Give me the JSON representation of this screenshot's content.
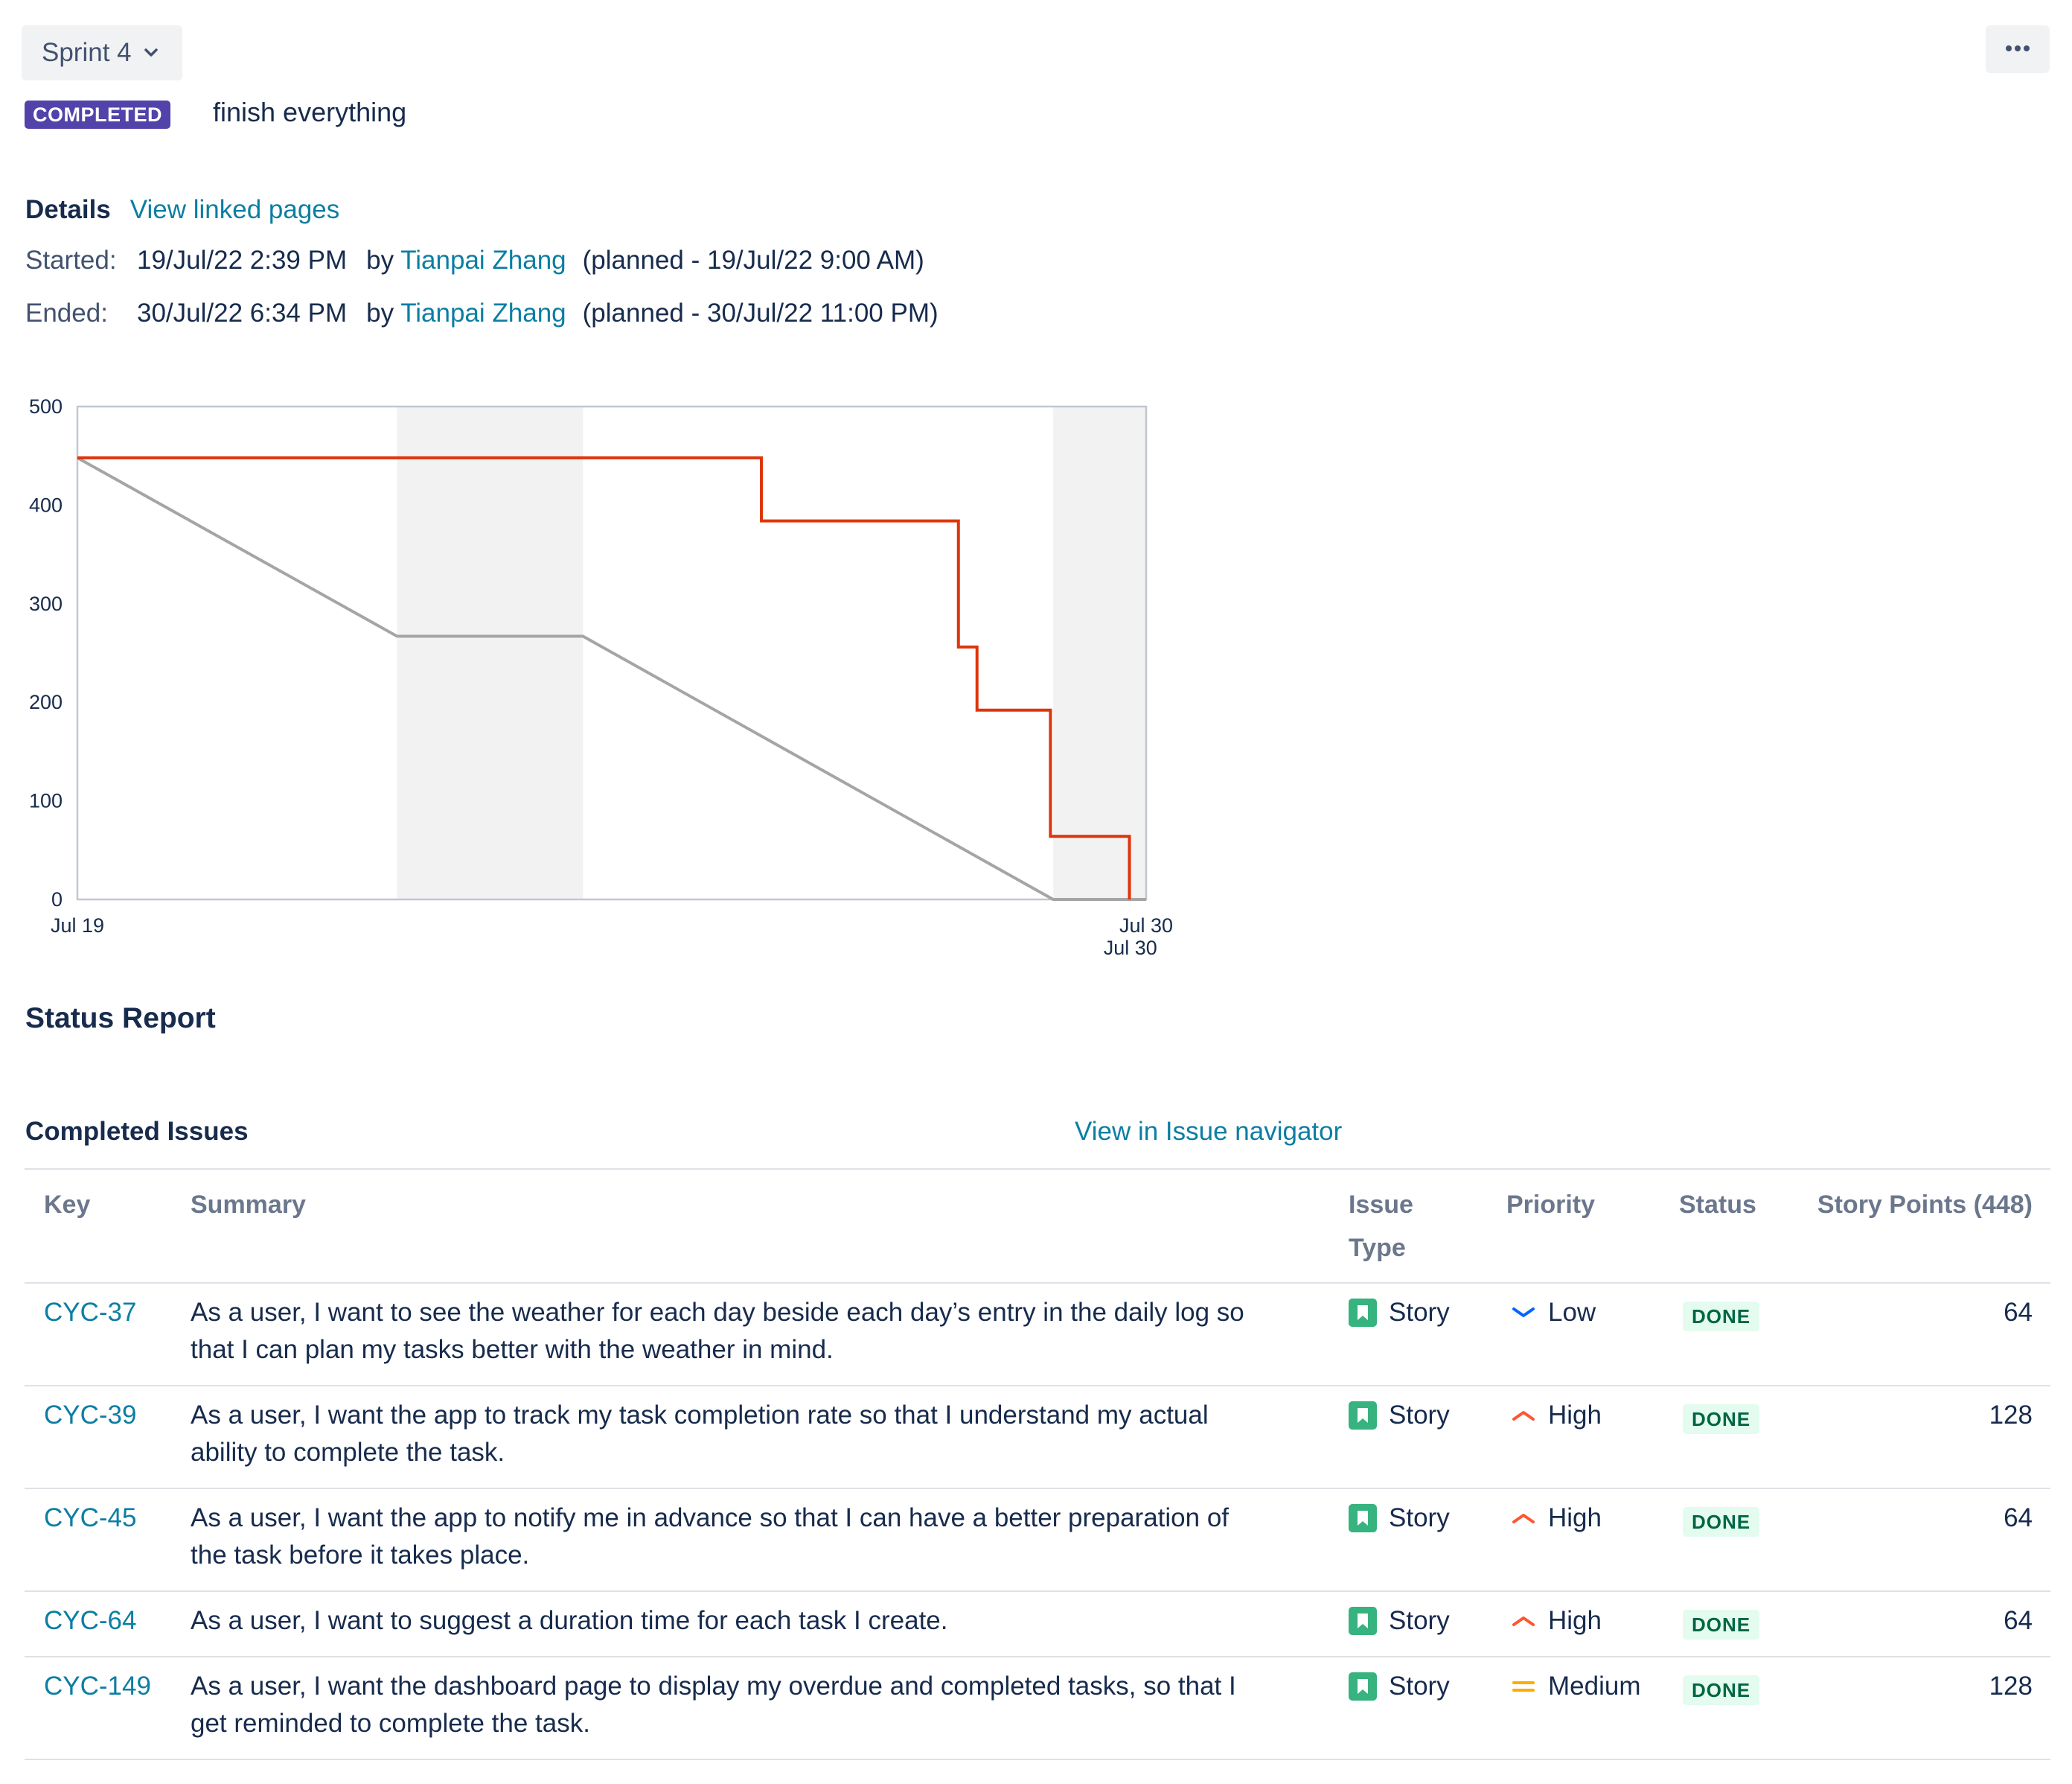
{
  "header": {
    "sprint_label": "Sprint 4",
    "status_lozenge": "COMPLETED",
    "goal": "finish everything"
  },
  "details": {
    "title": "Details",
    "link": "View linked pages",
    "started": {
      "label": "Started:",
      "value": "19/Jul/22 2:39 PM",
      "by": "by",
      "user": "Tianpai Zhang",
      "planned": "(planned - 19/Jul/22 9:00 AM)"
    },
    "ended": {
      "label": "Ended:",
      "value": "30/Jul/22 6:34 PM",
      "by": "by",
      "user": "Tianpai Zhang",
      "planned": "(planned - 30/Jul/22 11:00 PM)"
    }
  },
  "chart_data": {
    "type": "line",
    "title": "",
    "xlabel": "",
    "ylabel": "",
    "ylim": [
      0,
      500
    ],
    "yticks": [
      0,
      100,
      200,
      300,
      400,
      500
    ],
    "xlim_days": [
      0,
      11.5
    ],
    "xtick_labels": [
      {
        "label": "Jul 19",
        "day": 0
      },
      {
        "label": "Jul 30",
        "day": 11.5
      },
      {
        "label": "Jul 30",
        "day": 11.33
      }
    ],
    "weekends": [
      [
        3.44,
        5.44
      ],
      [
        10.5,
        11.5
      ]
    ],
    "colors": {
      "remaining": "#de350b",
      "guideline": "#a5a5a5",
      "weekend": "#f2f2f2"
    },
    "series": [
      {
        "role": "guideline",
        "points": [
          [
            0,
            448
          ],
          [
            3.44,
            267
          ],
          [
            5.44,
            267
          ],
          [
            10.5,
            0
          ],
          [
            11.5,
            0
          ]
        ]
      },
      {
        "role": "remaining",
        "points": [
          [
            0,
            448
          ],
          [
            7.36,
            448
          ],
          [
            7.36,
            384
          ],
          [
            9.48,
            384
          ],
          [
            9.48,
            256
          ],
          [
            9.68,
            256
          ],
          [
            9.68,
            192
          ],
          [
            10.47,
            192
          ],
          [
            10.47,
            64
          ],
          [
            11.32,
            64
          ],
          [
            11.32,
            0
          ]
        ]
      }
    ]
  },
  "report": {
    "title": "Status Report",
    "completed_title": "Completed Issues",
    "navigator_link": "View in Issue navigator",
    "columns": {
      "key": "Key",
      "summary": "Summary",
      "type_1": "Issue",
      "type_2": "Type",
      "priority": "Priority",
      "status": "Status",
      "points": "Story Points (448)"
    },
    "rows": [
      {
        "key": "CYC-37",
        "summary_1": "As a user, I want to see the weather for each day beside each day’s entry in the daily log so",
        "summary_2": "that I can plan my tasks better with the weather in mind.",
        "type": "Story",
        "priority": "Low",
        "priority_icon": "low",
        "status": "DONE",
        "points": "64"
      },
      {
        "key": "CYC-39",
        "summary_1": "As a user, I want the app to track my task completion rate so that I understand my actual",
        "summary_2": "ability to complete the task.",
        "type": "Story",
        "priority": "High",
        "priority_icon": "high",
        "status": "DONE",
        "points": "128"
      },
      {
        "key": "CYC-45",
        "summary_1": "As a user, I want the app to notify me in advance so that I can have a better preparation of",
        "summary_2": "the task before it takes place.",
        "type": "Story",
        "priority": "High",
        "priority_icon": "high",
        "status": "DONE",
        "points": "64"
      },
      {
        "key": "CYC-64",
        "summary_1": "As a user, I want to suggest a duration time for each task I create.",
        "summary_2": "",
        "type": "Story",
        "priority": "High",
        "priority_icon": "high",
        "status": "DONE",
        "points": "64"
      },
      {
        "key": "CYC-149",
        "summary_1": "As a user, I want the dashboard page to display my overdue and completed tasks, so that I",
        "summary_2": "get reminded to complete the task.",
        "type": "Story",
        "priority": "Medium",
        "priority_icon": "medium",
        "status": "DONE",
        "points": "128"
      }
    ]
  }
}
